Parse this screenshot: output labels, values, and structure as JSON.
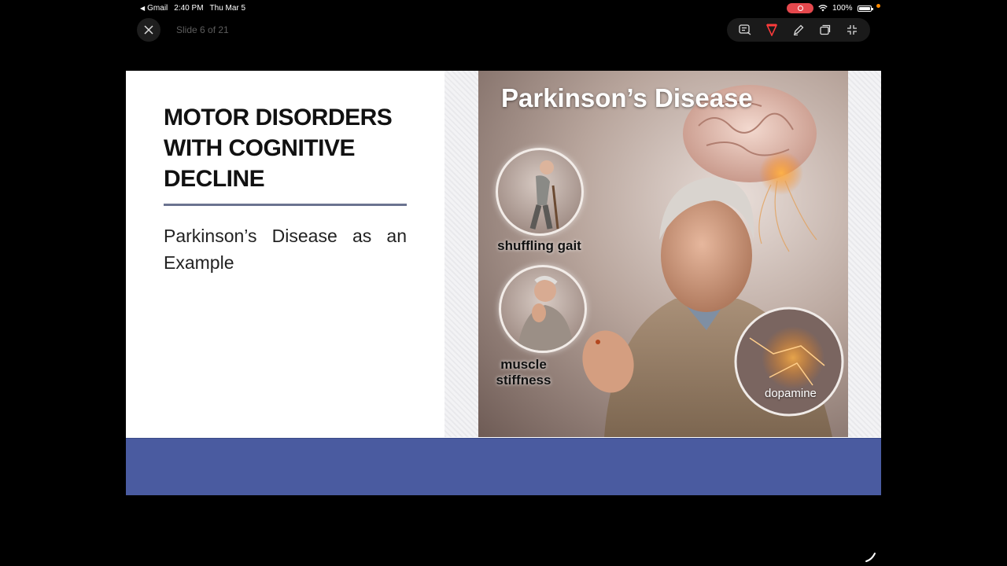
{
  "status_bar": {
    "back_app": "Gmail",
    "time": "2:40 PM",
    "date": "Thu Mar 5",
    "battery": "100%"
  },
  "viewer": {
    "slide_counter": "Slide 6 of 21",
    "close_icon": "close-icon",
    "tools": [
      "annotate-list-icon",
      "laser-pointer-icon",
      "pen-icon",
      "duplicate-window-icon",
      "exit-fullscreen-icon"
    ]
  },
  "slide": {
    "title": "MOTOR DISORDERS WITH COGNITIVE DECLINE",
    "subtitle": "Parkinson’s Disease as an Example",
    "colors": {
      "rule": "#6b7390",
      "bottom_bar": "#4a5ba0"
    },
    "illustration": {
      "title": "Parkinson’s Disease",
      "labels": {
        "gait": "shuffling gait",
        "stiffness": "muscle stiffness",
        "dopamine": "dopamine"
      }
    }
  }
}
